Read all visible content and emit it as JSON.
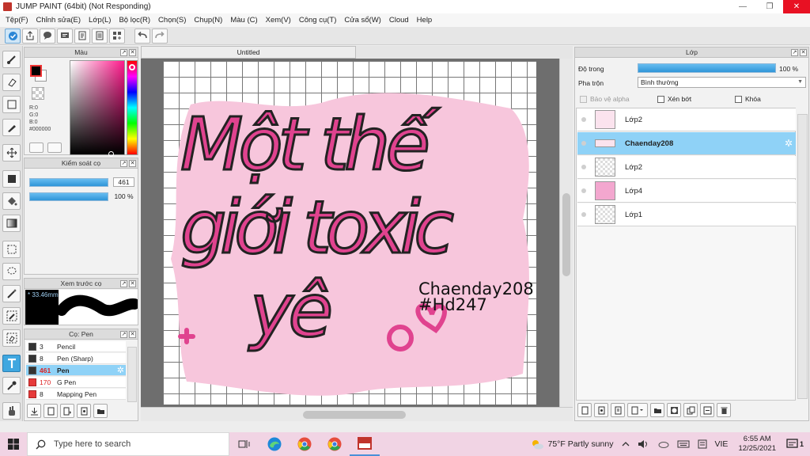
{
  "window": {
    "title": "JUMP PAINT (64bit) (Not Responding)",
    "minimize": "—",
    "maximize": "❐",
    "close": "✕"
  },
  "menu": [
    "Tệp(F)",
    "Chỉnh sửa(E)",
    "Lớp(L)",
    "Bộ lọc(R)",
    "Chọn(S)",
    "Chụp(N)",
    "Màu (C)",
    "Xem(V)",
    "Công cụ(T)",
    "Cửa sổ(W)",
    "Cloud",
    "Help"
  ],
  "color_panel": {
    "title": "Màu",
    "r": "R:0",
    "g": "G:0",
    "b": "B:0",
    "hex": "#000000",
    "fg": "#000000",
    "bg": "#ffffff"
  },
  "brush_control": {
    "title": "Kiểm soát cọ",
    "size": "461",
    "opacity": "100 %"
  },
  "brush_preview": {
    "title": "Xem trước cọ",
    "size_label": "* 33.46mm"
  },
  "brush_list": {
    "title": "Cọ: Pen",
    "items": [
      {
        "size": "3",
        "name": "Pencil",
        "color": "dark"
      },
      {
        "size": "8",
        "name": "Pen (Sharp)",
        "color": "dark"
      },
      {
        "size": "461",
        "name": "Pen",
        "color": "dark",
        "active": true
      },
      {
        "size": "170",
        "name": "G Pen",
        "color": "red"
      },
      {
        "size": "8",
        "name": "Mapping Pen",
        "color": "red"
      }
    ]
  },
  "canvas": {
    "tab": "Untitled",
    "lines": [
      "Một thế",
      "giới toxic",
      "yê"
    ],
    "signature": [
      "Chaenday208",
      "#Hd247"
    ],
    "pink": "#f7c6dc",
    "ink": "#e0438f"
  },
  "layer_panel": {
    "title": "Lớp",
    "opacity_label": "Độ trong",
    "opacity_value": "100 %",
    "blend_label": "Pha trộn",
    "blend_value": "Bình thường",
    "protect_alpha": "Bảo vệ alpha",
    "clipping": "Xén bớt",
    "lock": "Khóa",
    "layers": [
      {
        "name": "Lớp2",
        "thumb": "art"
      },
      {
        "name": "Chaenday208",
        "thumb": "art",
        "active": true
      },
      {
        "name": "Lớp2",
        "thumb": "check"
      },
      {
        "name": "Lớp4",
        "thumb": "pink"
      },
      {
        "name": "Lớp1",
        "thumb": "check"
      }
    ]
  },
  "taskbar": {
    "search_placeholder": "Type here to search",
    "weather": "75°F  Partly sunny",
    "lang": "VIE",
    "time": "6:55 AM",
    "date": "12/25/2021",
    "notifications": "1"
  }
}
